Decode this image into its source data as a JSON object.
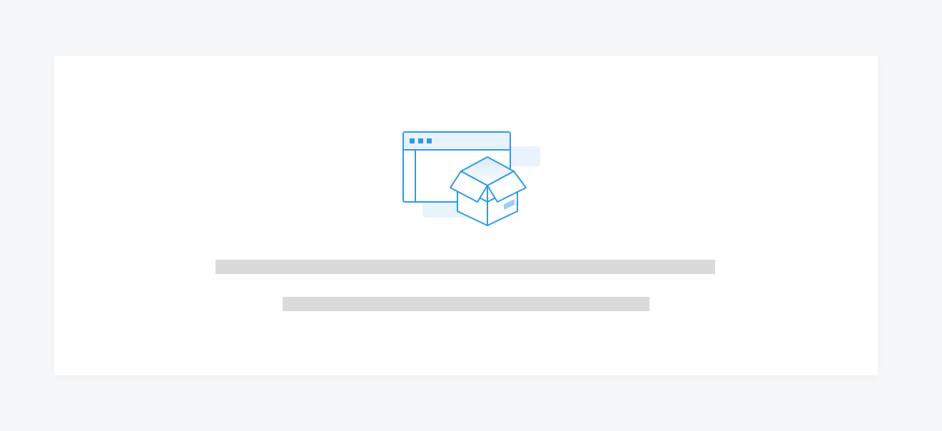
{
  "empty_state": {
    "illustration": {
      "icon": "empty-box-icon",
      "accent_color": "#2e9be8",
      "light_color": "#e6f2fd"
    },
    "skeleton_lines": 2,
    "skeleton_color": "#dadada"
  }
}
